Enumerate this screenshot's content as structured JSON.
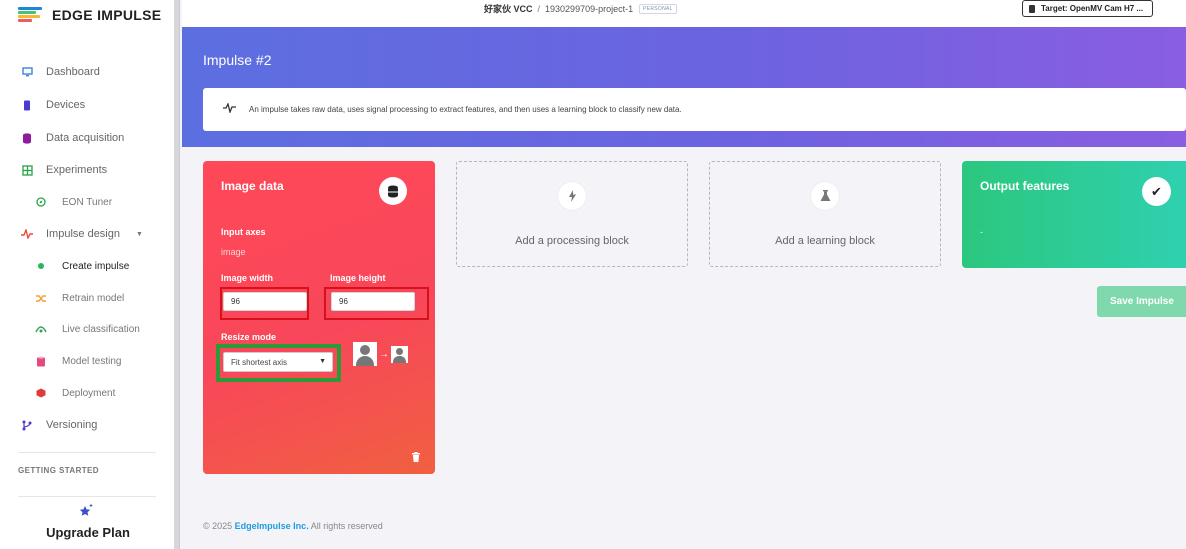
{
  "brand": {
    "name": "EDGE IMPULSE",
    "colors": [
      "#1f86d9",
      "#3fc47a",
      "#f7b733",
      "#f05a5a"
    ]
  },
  "sidebar": {
    "items": [
      {
        "label": "Dashboard",
        "icon": "monitor-icon",
        "color": "#2a7ae2"
      },
      {
        "label": "Devices",
        "icon": "chip-icon",
        "color": "#4a3bd1"
      },
      {
        "label": "Data acquisition",
        "icon": "database-icon",
        "color": "#8e1d9b"
      },
      {
        "label": "Experiments",
        "icon": "experiments-icon",
        "color": "#2aa147"
      },
      {
        "label": "EON Tuner",
        "icon": "compass-icon",
        "color": "#2aa147"
      },
      {
        "label": "Impulse design",
        "icon": "pulse-icon",
        "color": "#e94e3c"
      },
      {
        "label": "Create impulse",
        "icon": "dot-icon",
        "color": "#2ab660"
      },
      {
        "label": "Retrain model",
        "icon": "shuffle-icon",
        "color": "#f2a22e"
      },
      {
        "label": "Live classification",
        "icon": "live-icon",
        "color": "#31a25a"
      },
      {
        "label": "Model testing",
        "icon": "clipboard-icon",
        "color": "#e34b7e"
      },
      {
        "label": "Deployment",
        "icon": "package-icon",
        "color": "#e03a3a"
      },
      {
        "label": "Versioning",
        "icon": "branch-icon",
        "color": "#4b3bd1"
      }
    ],
    "section_label": "GETTING STARTED",
    "upgrade_label": "Upgrade Plan"
  },
  "topbar": {
    "user": "好家伙 VCC",
    "separator": "/",
    "project": "1930299709-project-1",
    "badge": "PERSONAL",
    "target": "Target: OpenMV Cam H7 ..."
  },
  "page": {
    "title": "Impulse #2",
    "info": "An impulse takes raw data, uses signal processing to extract features, and then uses a learning block to classify new data."
  },
  "image_block": {
    "title": "Image data",
    "input_axes_label": "Input axes",
    "input_axes_value": "image",
    "width_label": "Image width",
    "width_value": "96",
    "height_label": "Image height",
    "height_value": "96",
    "resize_label": "Resize mode",
    "resize_value": "Fit shortest axis"
  },
  "processing_block": {
    "label": "Add a processing block",
    "icon": "bolt-icon"
  },
  "learning_block": {
    "label": "Add a learning block",
    "icon": "flask-icon"
  },
  "output_block": {
    "title": "Output features",
    "value": "-"
  },
  "save_button": "Save Impulse",
  "footer": {
    "copyright": "© 2025",
    "company": "EdgeImpulse Inc.",
    "rights": "All rights reserved"
  }
}
